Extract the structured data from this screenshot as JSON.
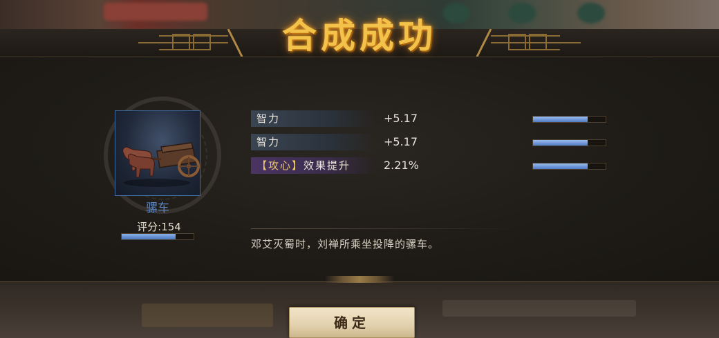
{
  "dialog": {
    "title": "合成成功"
  },
  "item": {
    "name": "骡车",
    "score_label": "评分:154",
    "score_fill": 0.75,
    "description": "邓艾灭蜀时，刘禅所乘坐投降的骡车。"
  },
  "attributes": [
    {
      "label": "智力",
      "value": "+5.17",
      "bar_fill": 0.75
    },
    {
      "label": "智力",
      "value": "+5.17",
      "bar_fill": 0.75
    },
    {
      "label_bracket": "【攻心】",
      "label": "效果提升",
      "value": "2.21%",
      "bar_fill": 0.75
    }
  ],
  "confirm_button": {
    "label": "确定"
  },
  "colors": {
    "title": "#f2c24a",
    "item_name": "#5b86c4",
    "bar_fill": "#4d7bc4",
    "special_label_bg": "#4a3463"
  }
}
